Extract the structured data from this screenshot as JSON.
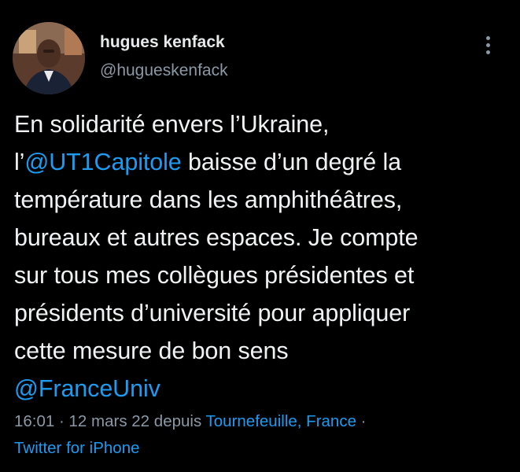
{
  "author": {
    "display_name": "hugues kenfack",
    "handle": "@hugueskenfack"
  },
  "tweet": {
    "line1": "En solidarité envers l’Ukraine,",
    "line2_prefix": "l’",
    "line2_mention": "@UT1Capitole",
    "line2_suffix": " baisse d’un degré la",
    "line3": "température dans les amphithéâtres,",
    "line4": "bureaux et autres espaces. Je compte",
    "line5": "sur tous mes collègues présidentes et",
    "line6": "présidents d’université pour appliquer",
    "line7": "cette mesure de bon sens",
    "line8_mention": "@FranceUniv"
  },
  "meta": {
    "time": "16:01",
    "separator": " · ",
    "date": "12 mars 22",
    "from_text": " depuis ",
    "location": "Tournefeuille, France",
    "separator2": " ·",
    "client": "Twitter for iPhone"
  },
  "colors": {
    "background": "#000000",
    "text": "#e7e9ea",
    "secondary": "#8b98a5",
    "link": "#1d9bf0"
  },
  "icons": {
    "more": "more-vertical-icon",
    "avatar": "profile-photo"
  }
}
